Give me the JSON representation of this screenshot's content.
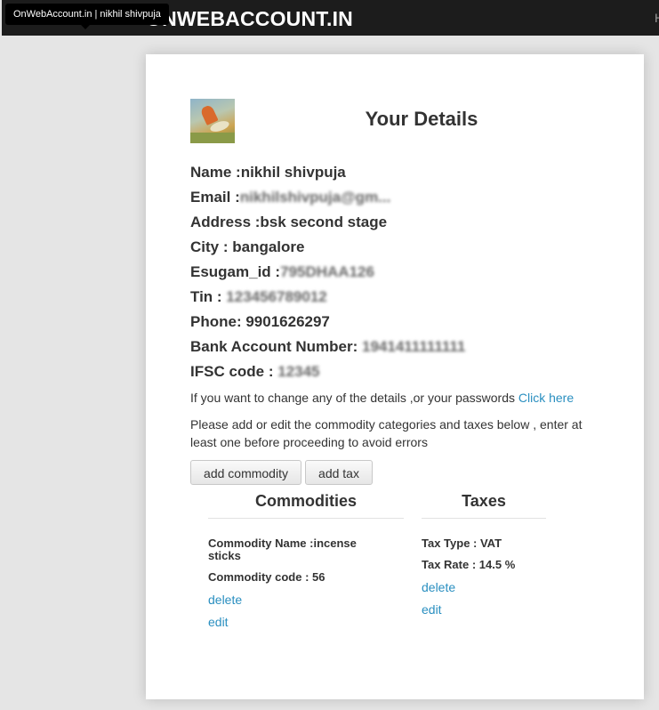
{
  "tooltip": "OnWebAccount.in | nikhil shivpuja",
  "navbar": {
    "brand": "ONWEBACCOUNT.IN",
    "right_item": "H"
  },
  "profile": {
    "title": "Your Details",
    "fields": {
      "name_label": "Name :",
      "name_value": "nikhil shivpuja",
      "email_label": "Email :",
      "email_value": "nikhilshivpuja@gm...",
      "address_label": "Address :",
      "address_value": "bsk second stage",
      "city_label": "City : ",
      "city_value": "bangalore",
      "esugam_label": "Esugam_id :",
      "esugam_value": "795DHAA126",
      "tin_label": "Tin : ",
      "tin_value": "123456789012",
      "phone_label": "Phone: ",
      "phone_value": "9901626297",
      "bank_label": "Bank Account Number: ",
      "bank_value": "1941411111111",
      "ifsc_label": "IFSC code : ",
      "ifsc_value": "12345"
    }
  },
  "change_notice": {
    "text": "If you want to change any of the details ,or your passwords ",
    "link": "Click here"
  },
  "instructions": "Please add or edit the commodity categories and taxes below , enter at least one before proceeding to avoid errors",
  "buttons": {
    "add_commodity": "add commodity",
    "add_tax": "add tax"
  },
  "commodities": {
    "heading": "Commodities",
    "items": [
      {
        "name_line": "Commodity Name :incense sticks",
        "code_line": "Commodity code : 56",
        "delete": "delete",
        "edit": "edit"
      }
    ]
  },
  "taxes": {
    "heading": "Taxes",
    "items": [
      {
        "type_line": "Tax Type : VAT",
        "rate_line": "Tax Rate : 14.5 %",
        "delete": "delete",
        "edit": "edit"
      }
    ]
  },
  "colors": {
    "link": "#2a8fc0",
    "navbar": "#1c1c1c",
    "background": "#e5e5e5"
  }
}
